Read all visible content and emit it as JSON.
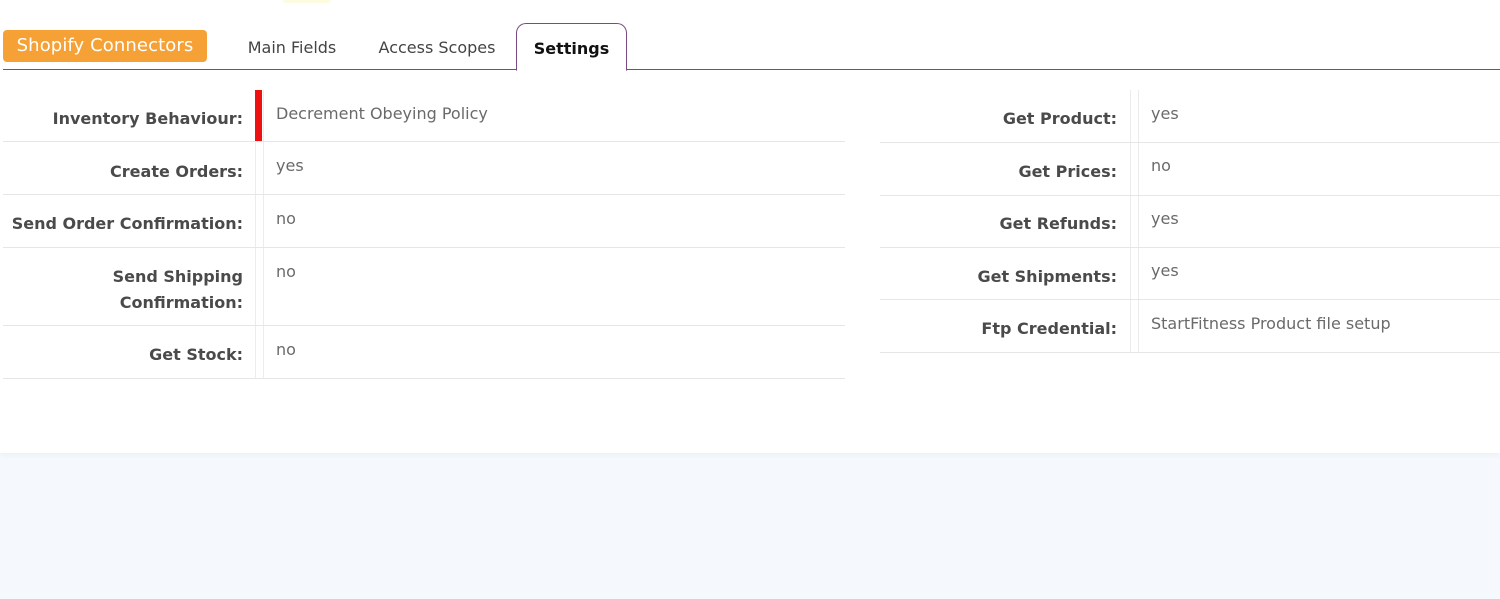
{
  "tabs": {
    "badge_label": "Shopify Connectors",
    "main_fields": "Main Fields",
    "access_scopes": "Access Scopes",
    "settings": "Settings"
  },
  "left_fields": [
    {
      "label": "Inventory Behaviour:",
      "value": "Decrement Obeying Policy"
    },
    {
      "label": "Create Orders:",
      "value": "yes"
    },
    {
      "label": "Send Order Confirmation:",
      "value": "no"
    },
    {
      "label": "Send Shipping Confirmation:",
      "value": "no"
    },
    {
      "label": "Get Stock:",
      "value": "no"
    }
  ],
  "right_fields": [
    {
      "label": "Get Product:",
      "value": "yes"
    },
    {
      "label": "Get Prices:",
      "value": "no"
    },
    {
      "label": "Get Refunds:",
      "value": "yes"
    },
    {
      "label": "Get Shipments:",
      "value": "yes"
    },
    {
      "label": "Ftp Credential:",
      "value": "StartFitness Product file setup"
    }
  ],
  "colors": {
    "badge": "#f6a135",
    "tab_border": "#7b4a86",
    "marker": "#ee1111",
    "page_background": "#f5f8fc"
  }
}
